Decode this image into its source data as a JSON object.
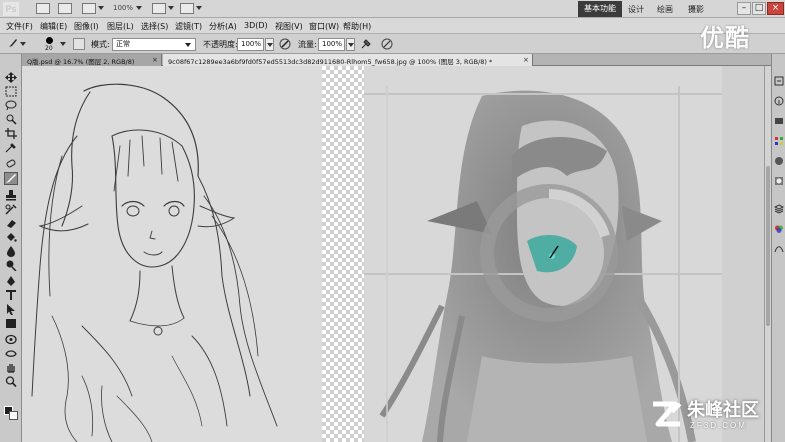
{
  "app": {
    "logo": "Ps",
    "zoom": "100%"
  },
  "workspace": {
    "active": "基本功能",
    "items": [
      "设计",
      "绘画",
      "摄影"
    ],
    "more": "»"
  },
  "window_controls": {
    "minimize": "–",
    "restore": "□",
    "close": "×"
  },
  "menu": {
    "items": [
      "文件(F)",
      "编辑(E)",
      "图像(I)",
      "图层(L)",
      "选择(S)",
      "滤镜(T)",
      "分析(A)",
      "3D(D)",
      "视图(V)",
      "窗口(W)",
      "帮助(H)"
    ]
  },
  "options": {
    "brush_size": "20",
    "mode_label": "模式:",
    "mode_value": "正常",
    "opacity_label": "不透明度:",
    "opacity_value": "100%",
    "flow_label": "流量:",
    "flow_value": "100%"
  },
  "tabs": [
    {
      "label": "Q版.psd @ 16.7% (图层 2, RGB/8)",
      "close": "×"
    },
    {
      "label": "9c08f67c1289ee3a6bf9fd0f57ed5513dc3d82d911680-Rlhom5_fw658.jpg @ 100% (图层 3, RGB/8) *",
      "close": "×"
    }
  ],
  "overlay": {
    "video_logo": "优酷",
    "brand_cn": "朱峰社区",
    "brand_en": "ZF3D.COM"
  },
  "colors": {
    "foreground": "#1f1f1f",
    "background": "#fafafa",
    "brush_cursor": "#1fb5a8"
  }
}
